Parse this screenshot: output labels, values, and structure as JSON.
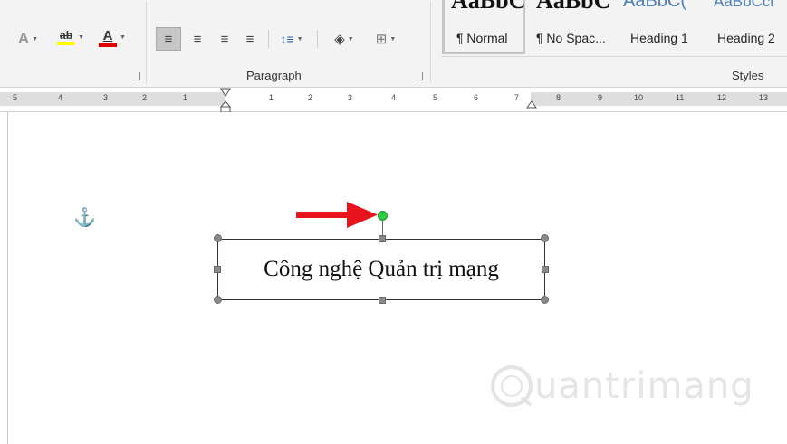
{
  "ribbon": {
    "font_group": {
      "text_effects_icon": "text-effects-icon",
      "highlight_label": "ab",
      "font_color_label": "A",
      "highlight_color": "#ffff00",
      "font_color": "#e00000"
    },
    "paragraph_group": {
      "label": "Paragraph"
    },
    "styles_group": {
      "label": "Styles",
      "items": [
        {
          "name": "¶ Normal",
          "preview": "AaBbC"
        },
        {
          "name": "¶ No Spac...",
          "preview": "AaBbC"
        },
        {
          "name": "Heading 1",
          "preview": "AaBbC("
        },
        {
          "name": "Heading 2",
          "preview": "AaBbCcl"
        }
      ]
    }
  },
  "ruler": {
    "left_labels": [
      "5",
      "4",
      "3",
      "2",
      "1"
    ],
    "right_labels": [
      "1",
      "2",
      "3",
      "4",
      "5",
      "6",
      "7",
      "8",
      "9",
      "10",
      "11",
      "12",
      "13"
    ]
  },
  "document": {
    "textbox_text": "Công nghệ Quản trị mạng",
    "anchor_icon": "anchor-icon",
    "arrow_color": "#e8141b",
    "rotation_handle_color": "#2ecc40"
  },
  "watermark": {
    "text": "uantrimang",
    "logo_letter": "Q"
  }
}
